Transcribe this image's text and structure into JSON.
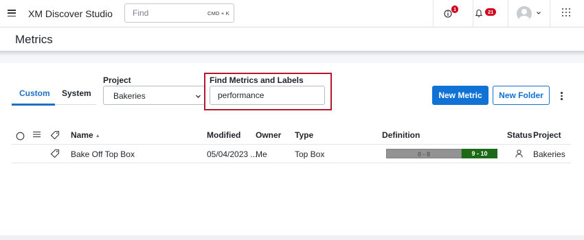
{
  "app": {
    "title": "XM Discover Studio",
    "find_placeholder": "Find",
    "find_shortcut": "CMD + K",
    "alerts_badge": "1",
    "notifications_badge": "21"
  },
  "page": {
    "title": "Metrics"
  },
  "tabs": [
    {
      "label": "Custom",
      "active": true
    },
    {
      "label": "System",
      "active": false
    }
  ],
  "filters": {
    "project_label": "Project",
    "project_value": "Bakeries",
    "search_label": "Find Metrics and Labels",
    "search_value": "performance"
  },
  "actions": {
    "new_metric": "New Metric",
    "new_folder": "New Folder"
  },
  "table": {
    "columns": {
      "name": "Name",
      "modified": "Modified",
      "owner": "Owner",
      "type": "Type",
      "definition": "Definition",
      "status": "Status",
      "project": "Project"
    },
    "rows": [
      {
        "name": "Bake Off Top Box",
        "modified": "05/04/2023 ...",
        "owner": "Me",
        "type": "Top Box",
        "definition_low": "0 - 8",
        "definition_high": "9 - 10",
        "project": "Bakeries"
      }
    ]
  },
  "colors": {
    "accent": "#1172d6",
    "highlight": "#b3192a",
    "badge": "#d0021b",
    "definition_low": "#939393",
    "definition_high": "#1c6a15"
  },
  "icons": [
    "hamburger-icon",
    "info-alert-icon",
    "bell-icon",
    "avatar",
    "chevron-down-icon",
    "app-grid-icon",
    "radio-icon",
    "list-icon",
    "tag-icon",
    "user-icon",
    "kebab-icon"
  ]
}
